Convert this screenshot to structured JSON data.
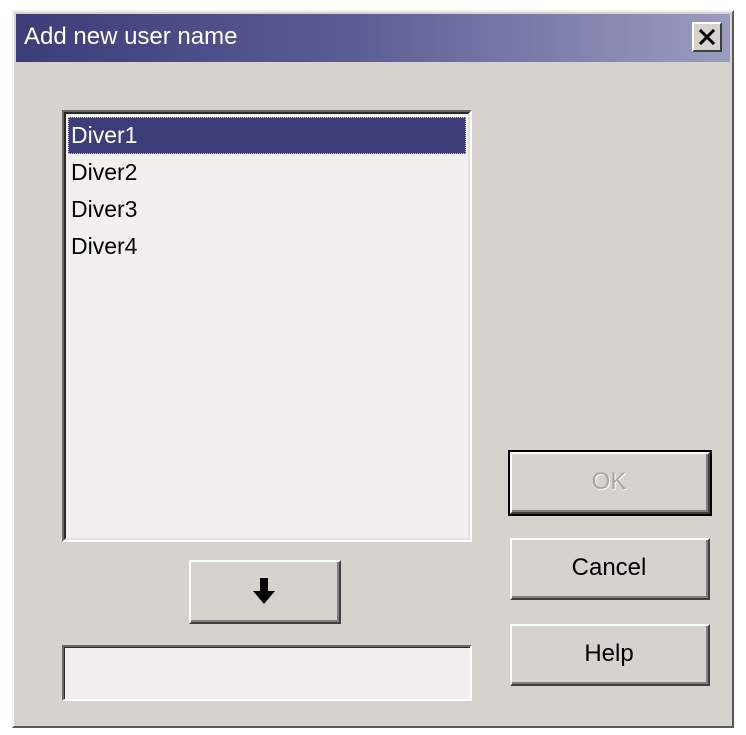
{
  "window": {
    "title": "Add new user name"
  },
  "user_list": {
    "items": [
      "Diver1",
      "Diver2",
      "Diver3",
      "Diver4"
    ],
    "selected": "Diver1"
  },
  "buttons": {
    "ok_label": "OK",
    "ok_enabled": false,
    "cancel_label": "Cancel",
    "help_label": "Help"
  },
  "name_input": {
    "value": ""
  },
  "icons": {
    "close": "close-icon",
    "move_down": "arrow-down-icon"
  },
  "colors": {
    "title_bar_start": "#3c3c78",
    "title_bar_end": "#9c9cc0",
    "dialog_face": "#d6d3ce",
    "selection": "#3c3c78",
    "list_background": "#f2f0ee"
  }
}
